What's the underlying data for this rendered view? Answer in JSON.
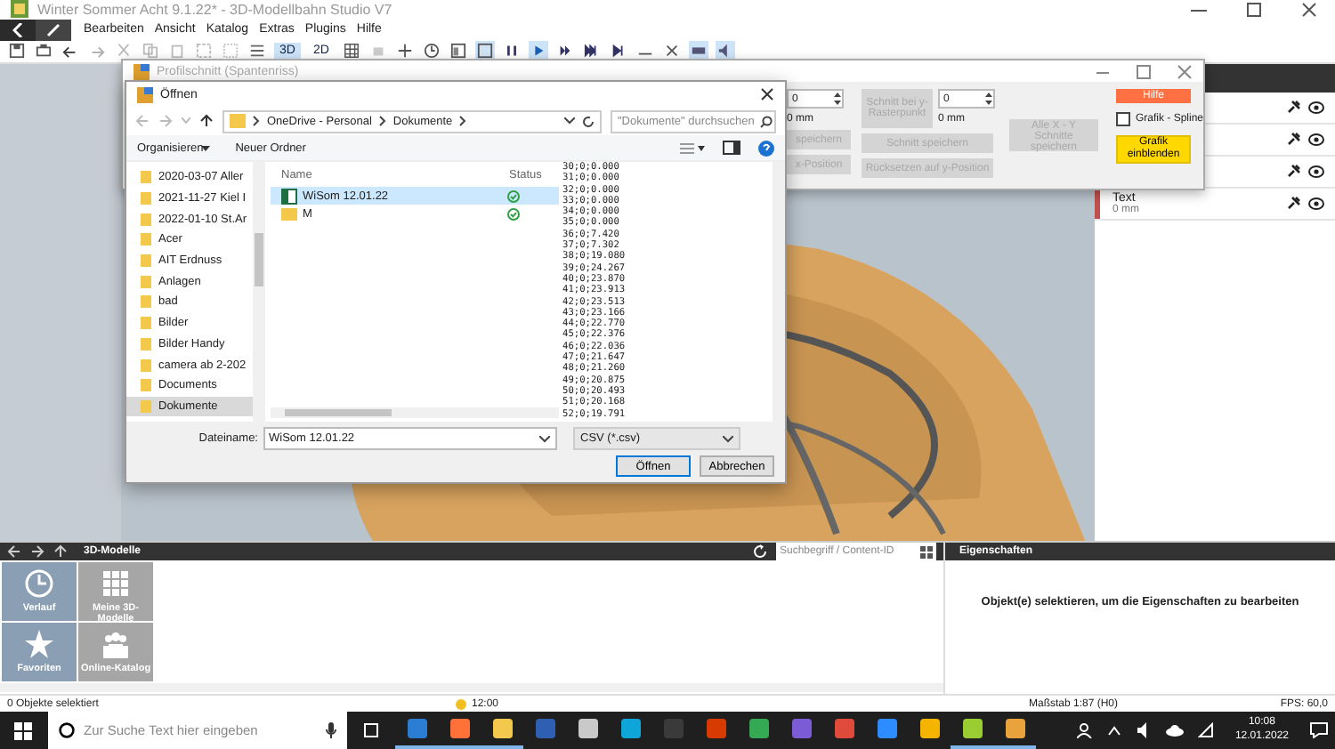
{
  "app_window": {
    "title": "Winter Sommer Acht 9.1.22* - 3D-Modellbahn Studio V7"
  },
  "menu": [
    "Bearbeiten",
    "Ansicht",
    "Katalog",
    "Extras",
    "Plugins",
    "Hilfe"
  ],
  "view_buttons": [
    {
      "label": "3D",
      "selected": true
    },
    {
      "label": "2D",
      "selected": false
    }
  ],
  "playback_buttons": [
    {
      "selected": false
    },
    {
      "selected": true
    },
    {
      "selected": false
    },
    {
      "selected": false
    },
    {
      "selected": false
    }
  ],
  "profile_window": {
    "title": "Profilschnitt (Spantenriss)",
    "x_value": "0",
    "x_reading": "0 mm",
    "y_button": "Schnitt bei y-Rasterpunkt",
    "y_value": "0",
    "y_reading": "0 mm",
    "save_partial": "speichern",
    "x_position_partial": "x-Position",
    "save_cut": "Schnitt speichern",
    "reset_y": "Rücksetzen auf y-Position",
    "save_all": "Alle X - Y Schnitte speichern",
    "help": "Hilfe",
    "spline": {
      "label": "Grafik - Spline",
      "checked": false
    },
    "show_graphic": "Grafik einblenden"
  },
  "layers": [
    {
      "kind": "icons_only"
    },
    {
      "kind": "icons_only"
    },
    {
      "kind": "icons_only"
    },
    {
      "kind": "labeled",
      "label": "Text",
      "reading": "0 mm",
      "color": "#c0504d"
    }
  ],
  "open_dialog": {
    "title": "Öffnen",
    "path": [
      "OneDrive - Personal",
      "Dokumente"
    ],
    "search": {
      "placeholder": "\"Dokumente\" durchsuchen"
    },
    "organize": "Organisieren",
    "new_folder": "Neuer Ordner",
    "folders": [
      {
        "name": "2020-03-07 Aller",
        "selected": false
      },
      {
        "name": "2021-11-27 Kiel I",
        "selected": false
      },
      {
        "name": "2022-01-10 St.Ar",
        "selected": false
      },
      {
        "name": "Acer",
        "selected": false
      },
      {
        "name": "AIT Erdnuss",
        "selected": false
      },
      {
        "name": "Anlagen",
        "selected": false
      },
      {
        "name": "bad",
        "selected": false
      },
      {
        "name": "Bilder",
        "selected": false
      },
      {
        "name": "Bilder Handy",
        "selected": false
      },
      {
        "name": "camera ab 2-202",
        "selected": false
      },
      {
        "name": "Documents",
        "selected": false
      },
      {
        "name": "Dokumente",
        "selected": true
      }
    ],
    "columns": [
      "Name",
      "Status"
    ],
    "files": [
      {
        "name": "WiSom 12.01.22",
        "kind": "csv",
        "selected": true
      },
      {
        "name": "M",
        "kind": "folder",
        "selected": false
      }
    ],
    "preview": [
      "30;0;0.000",
      "31;0;0.000",
      "32;0;0.000",
      "33;0;0.000",
      "34;0;0.000",
      "35;0;0.000",
      "36;0;7.420",
      "37;0;7.302",
      "38;0;19.080",
      "39;0;24.267",
      "40;0;23.870",
      "41;0;23.913",
      "42;0;23.513",
      "43;0;23.166",
      "44;0;22.770",
      "45;0;22.376",
      "46;0;22.036",
      "47;0;21.647",
      "48;0;21.260",
      "49;0;20.875",
      "50;0;20.493",
      "51;0;20.168",
      "52;0;19.791"
    ],
    "filename_label": "Dateiname:",
    "filename": "WiSom 12.01.22",
    "filetype": "CSV (*.csv)",
    "buttons": [
      "Öffnen",
      "Abbrechen"
    ]
  },
  "catalog": {
    "title": "3D-Modelle",
    "search": {
      "placeholder": "Suchbegriff / Content-ID"
    },
    "tiles": [
      {
        "label": "Verlauf",
        "color": "#8a9fb3"
      },
      {
        "label": "Meine 3D-Modelle",
        "color": "#a6a6a6"
      },
      {
        "label": "Favoriten",
        "color": "#8a9fb3"
      },
      {
        "label": "Online-Katalog",
        "color": "#a6a6a6"
      }
    ]
  },
  "properties": {
    "title": "Eigenschaften",
    "message": "Objekt(e) selektieren, um die Eigenschaften zu bearbeiten"
  },
  "status_bar": {
    "selection": "0 Objekte selektiert",
    "time": "12:00",
    "scale": "Maßstab 1:87 (H0)",
    "fps": "FPS: 60,0"
  },
  "taskbar": {
    "search": {
      "placeholder": "Zur Suche Text hier eingeben"
    },
    "time": "10:08",
    "date": "12.01.2022",
    "apps": [
      {
        "color": "#2b7cd3",
        "running": true
      },
      {
        "color": "#ff7139",
        "running": true
      },
      {
        "color": "#f2c94c",
        "running": true
      },
      {
        "color": "#2f5fb3",
        "running": false
      },
      {
        "color": "#c9c9c9",
        "running": false
      },
      {
        "color": "#0ea5d8",
        "running": false
      },
      {
        "color": "#3a3a3a",
        "running": false
      },
      {
        "color": "#d83b01",
        "running": false
      },
      {
        "color": "#34a853",
        "running": false
      },
      {
        "color": "#7b5cd6",
        "running": false
      },
      {
        "color": "#e04a3a",
        "running": false
      },
      {
        "color": "#2d8cff",
        "running": false
      },
      {
        "color": "#f5b400",
        "running": false
      },
      {
        "color": "#9acd32",
        "running": true
      },
      {
        "color": "#e8a33c",
        "running": true
      }
    ]
  }
}
